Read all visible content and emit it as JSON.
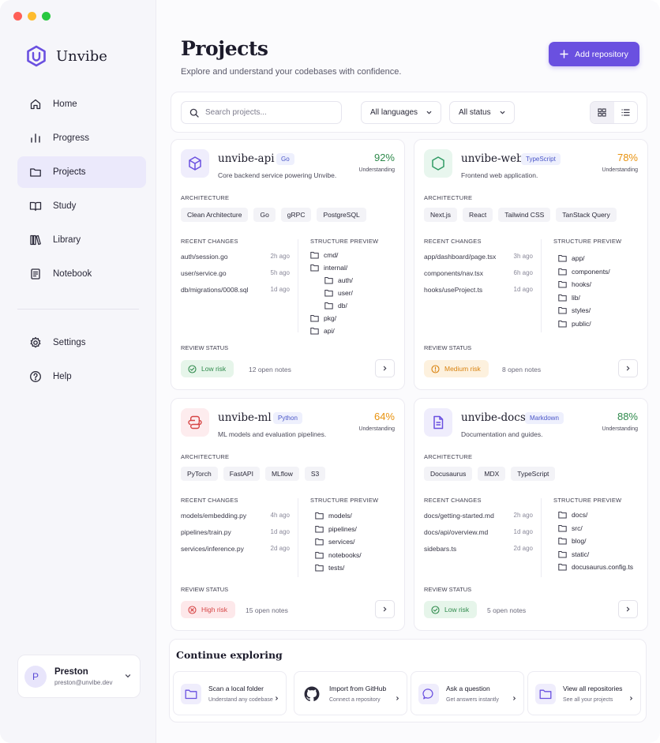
{
  "app": {
    "name": "Unvibe"
  },
  "nav": {
    "items": [
      {
        "label": "Home",
        "icon": "home-icon"
      },
      {
        "label": "Progress",
        "icon": "bar-chart-icon"
      },
      {
        "label": "Projects",
        "icon": "folder-icon",
        "active": true
      },
      {
        "label": "Study",
        "icon": "open-book-icon"
      },
      {
        "label": "Library",
        "icon": "library-icon"
      },
      {
        "label": "Notebook",
        "icon": "notebook-icon"
      }
    ],
    "secondary": [
      {
        "label": "Settings",
        "icon": "gear-icon"
      },
      {
        "label": "Help",
        "icon": "help-circle-icon"
      }
    ]
  },
  "user": {
    "initial": "P",
    "name": "Preston",
    "email": "preston@unvibe.dev"
  },
  "header": {
    "title": "Projects",
    "subtitle": "Explore and understand your codebases with confidence.",
    "add_button": "Add repository"
  },
  "toolbar": {
    "search_placeholder": "Search projects...",
    "language_filter": "All languages",
    "status_filter": "All status"
  },
  "labels": {
    "architecture": "ARCHITECTURE",
    "recent_changes": "RECENT CHANGES",
    "structure_preview": "STRUCTURE PREVIEW",
    "review_status": "REVIEW STATUS",
    "understanding": "Understanding"
  },
  "projects": [
    {
      "name": "unvibe-api",
      "language": "Go",
      "description": "Core backend service powering Unvibe.",
      "understanding": "92%",
      "color": "#2f8a4c",
      "icon": "cube-icon",
      "architecture": [
        "Clean Architecture",
        "Go",
        "gRPC",
        "PostgreSQL"
      ],
      "changes": [
        {
          "file": "auth/session.go",
          "time": "2h ago"
        },
        {
          "file": "user/service.go",
          "time": "5h ago"
        },
        {
          "file": "db/migrations/0008.sql",
          "time": "1d ago"
        }
      ],
      "tree": [
        {
          "name": "cmd/",
          "depth": 0
        },
        {
          "name": "internal/",
          "depth": 0
        },
        {
          "name": "auth/",
          "depth": 1
        },
        {
          "name": "user/",
          "depth": 1
        },
        {
          "name": "db/",
          "depth": 1
        },
        {
          "name": "pkg/",
          "depth": 0
        },
        {
          "name": "api/",
          "depth": 0
        }
      ],
      "status": "Low risk",
      "status_kind": "low",
      "notes": "12 open notes"
    },
    {
      "name": "unvibe-web",
      "language": "TypeScript",
      "description": "Frontend web application.",
      "understanding": "78%",
      "color": "#e8920e",
      "icon": "hexagon-icon",
      "architecture": [
        "Next.js",
        "React",
        "Tailwind CSS",
        "TanStack Query"
      ],
      "changes": [
        {
          "file": "app/dashboard/page.tsx",
          "time": "3h ago"
        },
        {
          "file": "components/nav.tsx",
          "time": "6h ago"
        },
        {
          "file": "hooks/useProject.ts",
          "time": "1d ago"
        }
      ],
      "tree": [
        {
          "name": "app/",
          "depth": 0
        },
        {
          "name": "components/",
          "depth": 0
        },
        {
          "name": "hooks/",
          "depth": 0
        },
        {
          "name": "lib/",
          "depth": 0
        },
        {
          "name": "styles/",
          "depth": 0
        },
        {
          "name": "public/",
          "depth": 0
        }
      ],
      "status": "Medium risk",
      "status_kind": "medium",
      "notes": "8 open notes"
    },
    {
      "name": "unvibe-ml",
      "language": "Python",
      "description": "ML models and evaluation pipelines.",
      "understanding": "64%",
      "color": "#e8920e",
      "icon": "python-icon",
      "architecture": [
        "PyTorch",
        "FastAPI",
        "MLflow",
        "S3"
      ],
      "changes": [
        {
          "file": "models/embedding.py",
          "time": "4h ago"
        },
        {
          "file": "pipelines/train.py",
          "time": "1d ago"
        },
        {
          "file": "services/inference.py",
          "time": "2d ago"
        }
      ],
      "tree": [
        {
          "name": "models/",
          "depth": 0
        },
        {
          "name": "pipelines/",
          "depth": 0
        },
        {
          "name": "services/",
          "depth": 0
        },
        {
          "name": "notebooks/",
          "depth": 0
        },
        {
          "name": "tests/",
          "depth": 0
        }
      ],
      "status": "High risk",
      "status_kind": "high",
      "notes": "15 open notes"
    },
    {
      "name": "unvibe-docs",
      "language": "Markdown",
      "description": "Documentation and guides.",
      "understanding": "88%",
      "color": "#2f8a4c",
      "icon": "document-icon",
      "architecture": [
        "Docusaurus",
        "MDX",
        "TypeScript"
      ],
      "changes": [
        {
          "file": "docs/getting-started.md",
          "time": "2h ago"
        },
        {
          "file": "docs/api/overview.md",
          "time": "1d ago"
        },
        {
          "file": "sidebars.ts",
          "time": "2d ago"
        }
      ],
      "tree": [
        {
          "name": "docs/",
          "depth": 0
        },
        {
          "name": "src/",
          "depth": 0
        },
        {
          "name": "blog/",
          "depth": 0
        },
        {
          "name": "static/",
          "depth": 0
        },
        {
          "name": "docusaurus.config.ts",
          "depth": 0,
          "file": true
        }
      ],
      "status": "Low risk",
      "status_kind": "low",
      "notes": "5 open notes"
    }
  ],
  "continue": {
    "title": "Continue exploring",
    "actions": [
      {
        "title": "Scan a local folder",
        "subtitle": "Understand any codebase",
        "icon": "folder-icon"
      },
      {
        "title": "Import from GitHub",
        "subtitle": "Connect a repository",
        "icon": "github-icon"
      },
      {
        "title": "Ask a question",
        "subtitle": "Get answers instantly",
        "icon": "chat-bubble-icon"
      },
      {
        "title": "View all repositories",
        "subtitle": "See all your projects",
        "icon": "folder-icon"
      }
    ]
  },
  "colors": {
    "accent": "#6a50e0",
    "green": "#2f8a4c",
    "orange": "#e8920e",
    "red": "#d64545"
  }
}
